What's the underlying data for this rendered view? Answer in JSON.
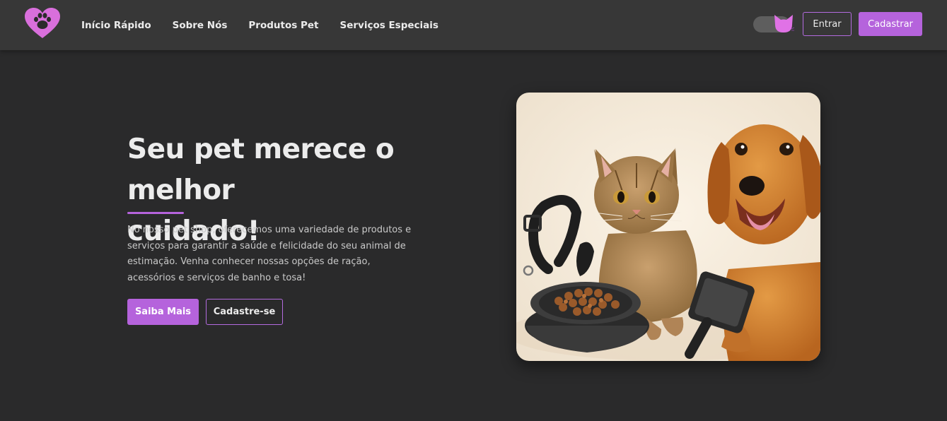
{
  "brand": {
    "logo_icon": "heart-paw-icon",
    "accent_color": "#b563dc"
  },
  "nav": {
    "links": [
      {
        "label": "Início Rápido"
      },
      {
        "label": "Sobre Nós"
      },
      {
        "label": "Produtos Pet"
      },
      {
        "label": "Serviços Especiais"
      }
    ],
    "theme_toggle_icon": "cat-head-icon",
    "login_label": "Entrar",
    "signup_label": "Cadastrar"
  },
  "hero": {
    "title_line1": "Seu pet merece o melhor",
    "title_line2": "cuidado!",
    "description": "No nosso pet shop, oferecemos uma variedade de produtos e serviços para garantir a saúde e felicidade do seu animal de estimação. Venha conhecer nossas opções de ração, acessórios e serviços de banho e tosa!",
    "primary_button": "Saiba Mais",
    "secondary_button": "Cadastre-se",
    "image_icon": "cat-and-dog-photo"
  }
}
